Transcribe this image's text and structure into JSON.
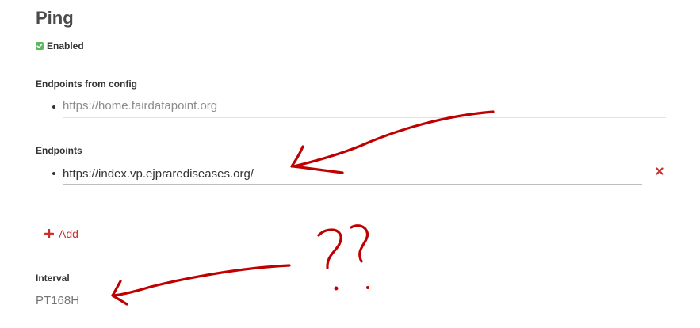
{
  "ping": {
    "title": "Ping",
    "enabled": {
      "label": "Enabled",
      "checked": true
    },
    "config_endpoints": {
      "label": "Endpoints from config",
      "items": [
        "https://home.fairdatapoint.org"
      ]
    },
    "endpoints": {
      "label": "Endpoints",
      "items": [
        {
          "value": "https://index.vp.ejprarediseases.org/"
        }
      ],
      "remove_icon": "close-icon",
      "add_label": "Add",
      "add_icon": "plus-icon"
    },
    "interval": {
      "label": "Interval",
      "placeholder": "PT168H",
      "value": ""
    }
  },
  "colors": {
    "accent": "#c9302c",
    "check": "#5cb85c",
    "annotation": "#c00000"
  }
}
